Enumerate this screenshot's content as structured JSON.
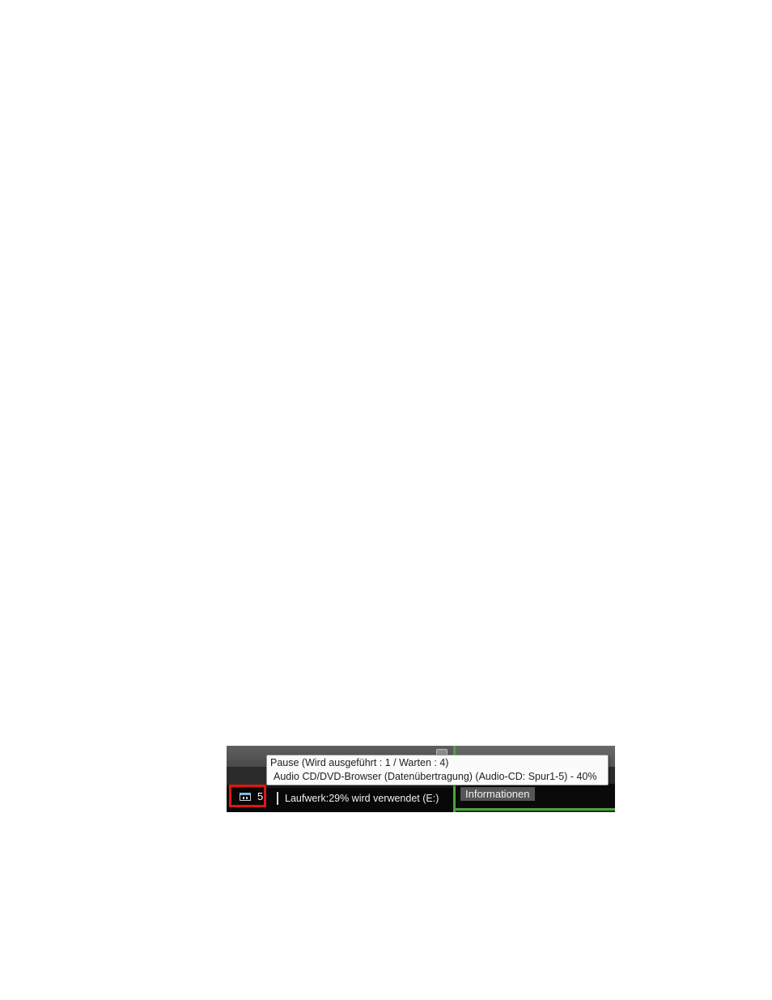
{
  "tooltip": {
    "line1": "Pause (Wird ausgeführt : 1 / Warten : 4)",
    "line2": "Audio CD/DVD-Browser (Datenübertragung) (Audio-CD: Spur1-5) - 40%"
  },
  "statusbar": {
    "task_count": "5",
    "drive_status": "Laufwerk:29% wird verwendet (E:)"
  },
  "right_panel": {
    "tab_label": "Informationen"
  },
  "icons": {
    "pause_icon": "pause-icon"
  },
  "colors": {
    "highlight_border": "#e01515",
    "divider_green": "#4aa53a"
  }
}
